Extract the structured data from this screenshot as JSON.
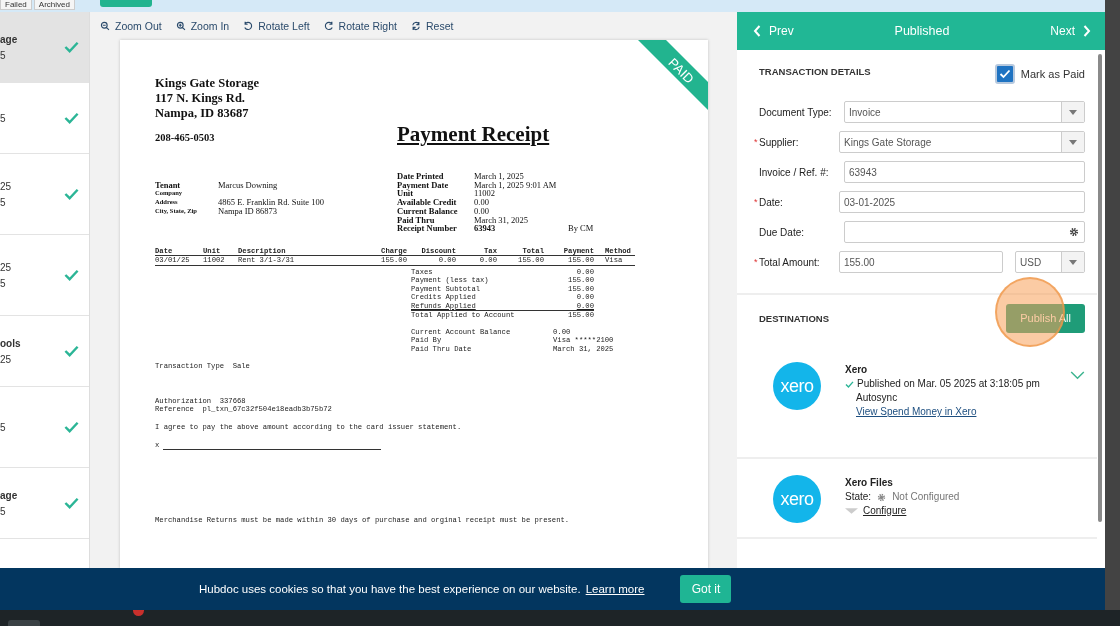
{
  "top_tabs": [
    {
      "label": "Failed",
      "selected": false
    },
    {
      "label": "Archived",
      "selected": false
    }
  ],
  "sidebar": {
    "items": [
      {
        "lines": [
          {
            "text": "age",
            "bold": true
          },
          {
            "text": "5",
            "bold": false
          }
        ],
        "selected": true,
        "done": true
      },
      {
        "lines": [
          {
            "text": "5",
            "bold": false
          }
        ],
        "selected": false,
        "done": true
      },
      {
        "lines": [
          {
            "text": "25",
            "bold": false
          },
          {
            "text": "5",
            "bold": false
          }
        ],
        "selected": false,
        "done": true
      },
      {
        "lines": [
          {
            "text": "25",
            "bold": false
          },
          {
            "text": "5",
            "bold": false
          }
        ],
        "selected": false,
        "done": true
      },
      {
        "lines": [
          {
            "text": "ools",
            "bold": true
          },
          {
            "text": "25",
            "bold": false
          }
        ],
        "selected": false,
        "done": true
      },
      {
        "lines": [
          {
            "text": "5",
            "bold": false
          }
        ],
        "selected": false,
        "done": true
      },
      {
        "lines": [
          {
            "text": "age",
            "bold": true
          },
          {
            "text": "5",
            "bold": false
          }
        ],
        "selected": false,
        "done": true
      }
    ]
  },
  "viewer_toolbar": [
    {
      "kind": "zoom-out",
      "label": "Zoom Out"
    },
    {
      "kind": "zoom-in",
      "label": "Zoom In"
    },
    {
      "kind": "rotate-left",
      "label": "Rotate Left"
    },
    {
      "kind": "rotate-right",
      "label": "Rotate Right"
    },
    {
      "kind": "reset",
      "label": "Reset"
    }
  ],
  "document": {
    "stamp": "PAID",
    "company_lines": [
      "Kings Gate Storage",
      "117 N. Kings Rd.",
      "Nampa, ID  83687"
    ],
    "phone": "208-465-0503",
    "title": "Payment Receipt",
    "tenant_fields": [
      {
        "label": "Tenant",
        "value": "Marcus Downing"
      },
      {
        "label": "Company"
      },
      {
        "label": "Address",
        "value": "4865 E. Franklin Rd. Suite 100"
      },
      {
        "label": "City, State, Zip",
        "value": "Nampa  ID  86873"
      }
    ],
    "receipt_fields": [
      {
        "label": "Date Printed",
        "value": "March 1, 2025",
        "bold": false
      },
      {
        "label": "Payment Date",
        "value": "March 1, 2025 9:01 AM",
        "bold": false
      },
      {
        "label": "Unit",
        "value": "11002",
        "bold": false
      },
      {
        "label": "Available Credit",
        "value": "0.00",
        "bold": false
      },
      {
        "label": "Current Balance",
        "value": "0.00",
        "bold": false
      },
      {
        "label": "Paid Thru",
        "value": "March 31, 2025",
        "bold": false
      },
      {
        "label": "Receipt Number",
        "value": "63943",
        "bold": true
      }
    ],
    "by": "By CM",
    "table": {
      "columns": [
        "Date",
        "Unit",
        "Description",
        "Charge",
        "Discount",
        "Tax",
        "Total",
        "Payment",
        "Method"
      ],
      "rows": [
        [
          "03/01/25",
          "11002",
          "Rent 3/1-3/31",
          "155.00",
          "0.00",
          "0.00",
          "155.00",
          "155.00",
          "Visa"
        ]
      ]
    },
    "totals": [
      {
        "label": "Taxes",
        "value": "0.00"
      },
      {
        "label": "Payment (less tax)",
        "value": "155.00"
      },
      {
        "label": "Payment Subtotal",
        "value": "155.00"
      },
      {
        "label": "Credits Applied",
        "value": "0.00"
      },
      {
        "label": "Refunds Applied",
        "value": "0.00"
      },
      {
        "label": "Total Applied to Account",
        "value": "155.00"
      }
    ],
    "account": [
      {
        "label": "Current Account Balance",
        "value": "0.00"
      },
      {
        "label": "Paid By",
        "value": "Visa *****2100"
      },
      {
        "label": "Paid Thru Date",
        "value": "March 31, 2025"
      }
    ],
    "transaction_type": "Transaction Type  Sale",
    "authorization": "Authorization  337668",
    "reference": "Reference  pl_txn_67c32f504e18eadb3b75b72",
    "agreement": "I agree to pay the above amount according to the card issuer statement.",
    "signature_mark": "x",
    "returns_note": "Merchandise Returns must be made within 30 days of purchase and orginal receipt must be present."
  },
  "panel": {
    "prev": "Prev",
    "status": "Published",
    "next": "Next",
    "details_heading": "TRANSACTION DETAILS",
    "mark_as_paid": {
      "label": "Mark as Paid",
      "checked": true
    },
    "required_mark": "*",
    "fields": [
      {
        "kind": "select",
        "label": "Document Type:",
        "required": false,
        "value": "Invoice"
      },
      {
        "kind": "select",
        "label": "Supplier:",
        "required": true,
        "value": "Kings Gate Storage"
      },
      {
        "kind": "text",
        "label": "Invoice / Ref. #:",
        "required": false,
        "value": "63943"
      },
      {
        "kind": "text",
        "label": "Date:",
        "required": true,
        "value": "03-01-2025"
      },
      {
        "kind": "date",
        "label": "Due Date:",
        "required": false
      },
      {
        "kind": "amount",
        "label": "Total Amount:",
        "required": true,
        "value": "155.00",
        "currency": "USD"
      }
    ],
    "destinations_heading": "DESTINATIONS",
    "publish_button": "Publish All",
    "destinations": [
      {
        "kind": "published",
        "logo": "xero",
        "name": "Xero",
        "status": "Published on Mar. 05 2025 at 3:18:05 pm",
        "sync": "Autosync",
        "link": "View Spend Money in Xero"
      },
      {
        "kind": "unconfigured",
        "logo": "xero",
        "name": "Xero Files",
        "state_label": "State:",
        "status": "Not Configured",
        "link": "Configure"
      }
    ]
  },
  "cookie_banner": {
    "message": "Hubdoc uses cookies so that you have the best experience on our website.",
    "link": "Learn more",
    "button": "Got it"
  }
}
